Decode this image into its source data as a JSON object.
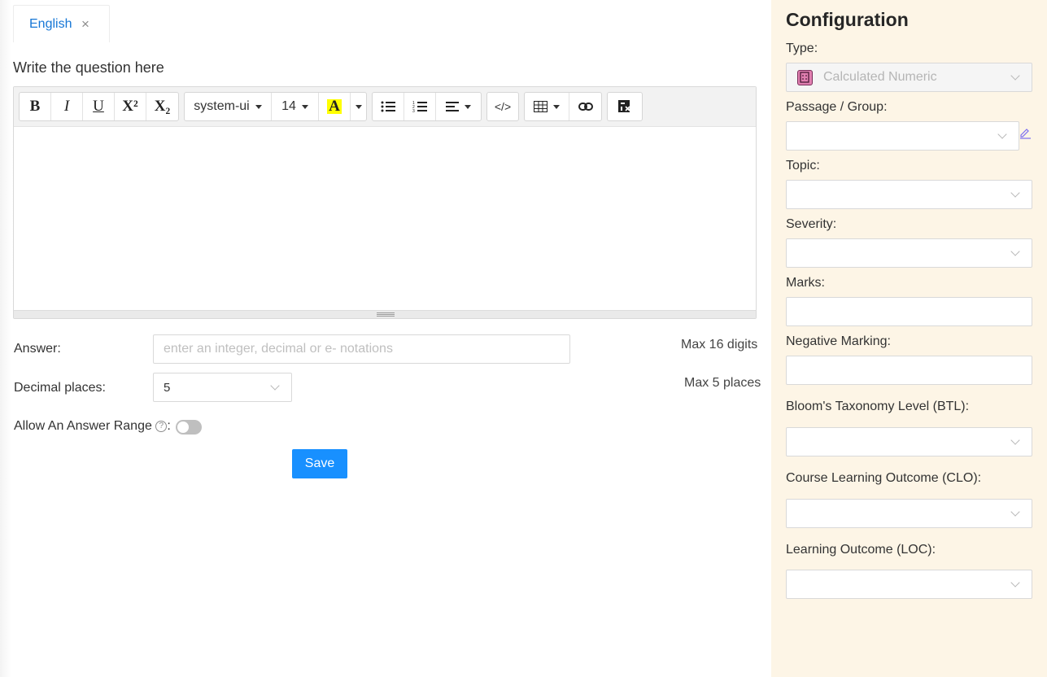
{
  "tab": {
    "label": "English",
    "close_glyph": "×"
  },
  "editor": {
    "prompt": "Write the question here",
    "toolbar": {
      "bold": "B",
      "italic": "I",
      "underline": "U",
      "superscript": "X²",
      "subscript": "X₂",
      "font_family": "system-ui",
      "font_size": "14",
      "highlight": "A",
      "code": "</>"
    }
  },
  "answer": {
    "label": "Answer:",
    "placeholder": "enter an integer, decimal or e- notations",
    "hint": "Max 16 digits"
  },
  "decimal_places": {
    "label": "Decimal places:",
    "value": "5",
    "hint": "Max 5 places"
  },
  "answer_range": {
    "label": "Allow An Answer Range",
    "help_glyph": "?",
    "suffix": ":",
    "enabled": false
  },
  "save_label": "Save",
  "config": {
    "title": "Configuration",
    "type": {
      "label": "Type:",
      "value": "Calculated Numeric",
      "icon": "calculator-icon"
    },
    "passage": {
      "label": "Passage / Group:"
    },
    "topic": {
      "label": "Topic:"
    },
    "severity": {
      "label": "Severity:"
    },
    "marks": {
      "label": "Marks:"
    },
    "negative_marking": {
      "label": "Negative Marking:"
    },
    "btl": {
      "label": "Bloom's Taxonomy Level (BTL):"
    },
    "clo": {
      "label": "Course Learning Outcome (CLO):"
    },
    "loc": {
      "label": "Learning Outcome (LOC):"
    }
  },
  "colors": {
    "accent": "#1890ff",
    "panel_bg": "#fdf5e6",
    "highlight": "#ffff00"
  }
}
